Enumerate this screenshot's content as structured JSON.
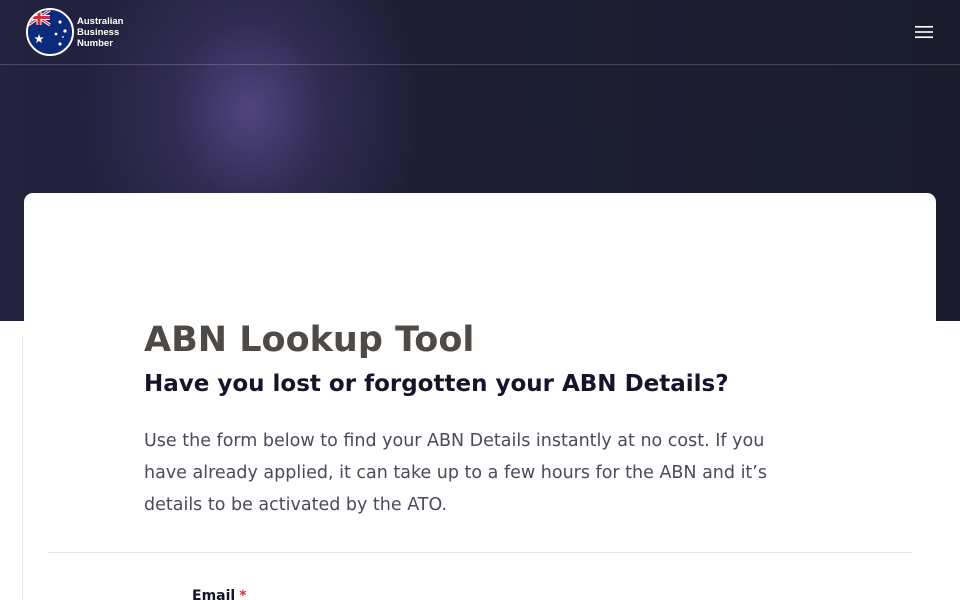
{
  "header": {
    "logo": {
      "line1": "Australian",
      "line2": "Business",
      "line3": "Number",
      "icon": "australian-flag-icon"
    },
    "menu_icon": "hamburger-menu-icon"
  },
  "main": {
    "title": "ABN Lookup Tool",
    "subtitle": "Have you lost or forgotten your ABN Details?",
    "intro": "Use the form below to find your ABN Details instantly at no cost. If you have already applied, it can take up to a few hours for the ABN and it’s details to be activated by the ATO."
  },
  "form": {
    "email_label": "Email",
    "required_marker": "*"
  },
  "colors": {
    "hero_background": "#1b1d30",
    "title": "#4f4a45",
    "subtitle": "#14142b",
    "required": "#e0303b"
  }
}
